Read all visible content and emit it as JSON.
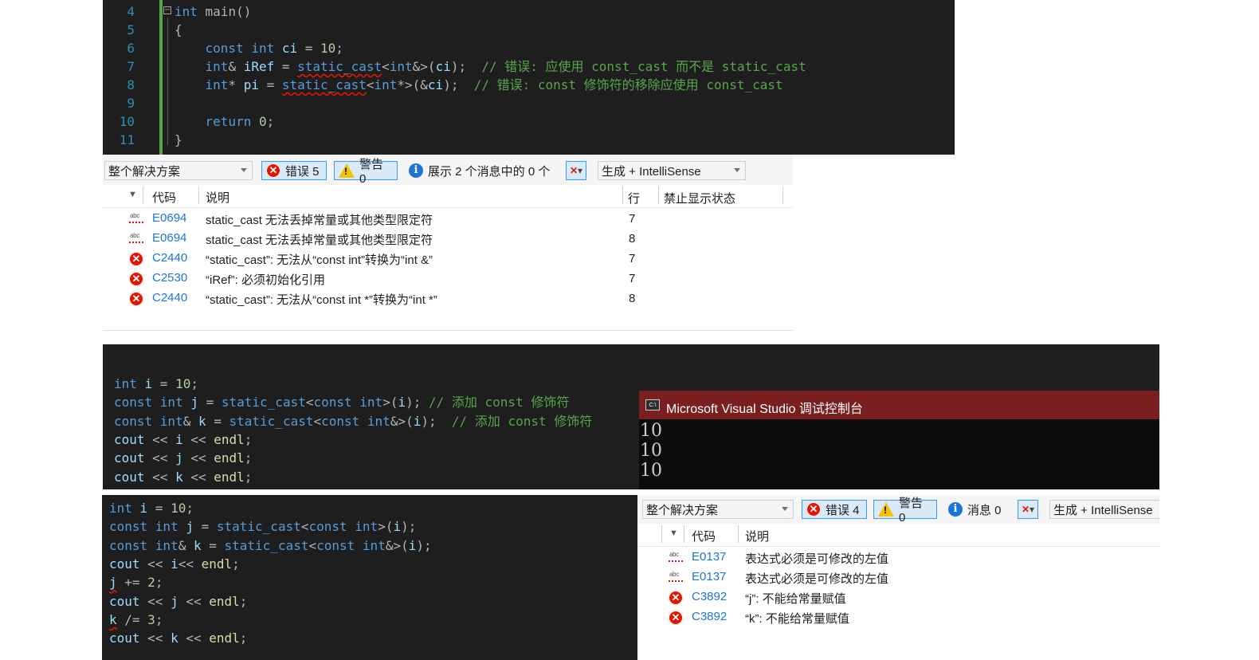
{
  "top_editor": {
    "lines": [
      {
        "num": "4",
        "segments": [
          {
            "t": "int",
            "c": "kw"
          },
          {
            "t": " main()",
            "c": "op"
          }
        ]
      },
      {
        "num": "5",
        "segments": [
          {
            "t": "{",
            "c": "op"
          }
        ]
      },
      {
        "num": "6",
        "segments": [
          {
            "t": "    const int ",
            "c": "kw"
          },
          {
            "t": "ci",
            "c": "id"
          },
          {
            "t": " = ",
            "c": "op"
          },
          {
            "t": "10",
            "c": "nm"
          },
          {
            "t": ";",
            "c": "op"
          }
        ]
      },
      {
        "num": "7",
        "segments": [
          {
            "t": "    int",
            "c": "kw"
          },
          {
            "t": "& ",
            "c": "op"
          },
          {
            "t": "iRef",
            "c": "id"
          },
          {
            "t": " = ",
            "c": "op"
          },
          {
            "t": "static_cast",
            "c": "kw squig"
          },
          {
            "t": "<",
            "c": "op"
          },
          {
            "t": "int",
            "c": "kw"
          },
          {
            "t": "&>(",
            "c": "op"
          },
          {
            "t": "ci",
            "c": "id"
          },
          {
            "t": ");  ",
            "c": "op"
          },
          {
            "t": "// 错误: 应使用 const_cast 而不是 static_cast",
            "c": "cm"
          }
        ]
      },
      {
        "num": "8",
        "segments": [
          {
            "t": "    int",
            "c": "kw"
          },
          {
            "t": "* ",
            "c": "op"
          },
          {
            "t": "pi",
            "c": "id"
          },
          {
            "t": " = ",
            "c": "op"
          },
          {
            "t": "static_cast",
            "c": "kw squig"
          },
          {
            "t": "<",
            "c": "op"
          },
          {
            "t": "int",
            "c": "kw"
          },
          {
            "t": "*>(&",
            "c": "op"
          },
          {
            "t": "ci",
            "c": "id"
          },
          {
            "t": ");  ",
            "c": "op"
          },
          {
            "t": "// 错误: const 修饰符的移除应使用 const_cast",
            "c": "cm"
          }
        ]
      },
      {
        "num": "9",
        "segments": []
      },
      {
        "num": "10",
        "segments": [
          {
            "t": "    return ",
            "c": "kw"
          },
          {
            "t": "0",
            "c": "nm"
          },
          {
            "t": ";",
            "c": "op"
          }
        ]
      },
      {
        "num": "11",
        "segments": [
          {
            "t": "}",
            "c": "op"
          }
        ]
      }
    ]
  },
  "error_list_1": {
    "scope": "整个解决方案",
    "errors_label": "错误 5",
    "warnings_label": "警告 0",
    "messages_label": "展示 2 个消息中的 0 个",
    "build_label": "生成 + IntelliSense",
    "headers": {
      "code": "代码",
      "desc": "说明",
      "line": "行",
      "suppress": "禁止显示状态"
    },
    "rows": [
      {
        "icon": "abc",
        "code": "E0694",
        "desc": "static_cast 无法丢掉常量或其他类型限定符",
        "line": "7"
      },
      {
        "icon": "abc",
        "code": "E0694",
        "desc": "static_cast 无法丢掉常量或其他类型限定符",
        "line": "8"
      },
      {
        "icon": "err",
        "code": "C2440",
        "desc": "“static_cast”: 无法从“const int”转换为“int &”",
        "line": "7"
      },
      {
        "icon": "err",
        "code": "C2530",
        "desc": "“iRef”: 必须初始化引用",
        "line": "7"
      },
      {
        "icon": "err",
        "code": "C2440",
        "desc": "“static_cast”: 无法从“const int *”转换为“int *”",
        "line": "8"
      }
    ]
  },
  "mid_editor": {
    "lines": [
      [
        {
          "t": "int ",
          "c": "kw"
        },
        {
          "t": "i",
          "c": "id"
        },
        {
          "t": " = ",
          "c": "op"
        },
        {
          "t": "10",
          "c": "nm"
        },
        {
          "t": ";",
          "c": "op"
        }
      ],
      [
        {
          "t": "const int ",
          "c": "kw"
        },
        {
          "t": "j",
          "c": "id"
        },
        {
          "t": " = ",
          "c": "op"
        },
        {
          "t": "static_cast",
          "c": "kw"
        },
        {
          "t": "<",
          "c": "op"
        },
        {
          "t": "const int",
          "c": "kw"
        },
        {
          "t": ">(",
          "c": "op"
        },
        {
          "t": "i",
          "c": "id"
        },
        {
          "t": "); ",
          "c": "op"
        },
        {
          "t": "// 添加 const 修饰符",
          "c": "cm"
        }
      ],
      [
        {
          "t": "const int",
          "c": "kw"
        },
        {
          "t": "& ",
          "c": "op"
        },
        {
          "t": "k",
          "c": "id"
        },
        {
          "t": " = ",
          "c": "op"
        },
        {
          "t": "static_cast",
          "c": "kw"
        },
        {
          "t": "<",
          "c": "op"
        },
        {
          "t": "const int",
          "c": "kw"
        },
        {
          "t": "&>(",
          "c": "op"
        },
        {
          "t": "i",
          "c": "id"
        },
        {
          "t": ");  ",
          "c": "op"
        },
        {
          "t": "// 添加 const 修饰符",
          "c": "cm"
        }
      ],
      [
        {
          "t": "cout",
          "c": "id"
        },
        {
          "t": " << ",
          "c": "op"
        },
        {
          "t": "i",
          "c": "id"
        },
        {
          "t": " << ",
          "c": "op"
        },
        {
          "t": "endl",
          "c": "fn"
        },
        {
          "t": ";",
          "c": "op"
        }
      ],
      [
        {
          "t": "cout",
          "c": "id"
        },
        {
          "t": " << ",
          "c": "op"
        },
        {
          "t": "j",
          "c": "id"
        },
        {
          "t": " << ",
          "c": "op"
        },
        {
          "t": "endl",
          "c": "fn"
        },
        {
          "t": ";",
          "c": "op"
        }
      ],
      [
        {
          "t": "cout",
          "c": "id"
        },
        {
          "t": " << ",
          "c": "op"
        },
        {
          "t": "k",
          "c": "id"
        },
        {
          "t": " << ",
          "c": "op"
        },
        {
          "t": "endl",
          "c": "fn"
        },
        {
          "t": ";",
          "c": "op"
        }
      ]
    ]
  },
  "console": {
    "title": "Microsoft Visual Studio 调试控制台",
    "output": [
      "10",
      "10",
      "10"
    ]
  },
  "bottom_editor": {
    "lines": [
      [
        {
          "t": "int ",
          "c": "kw"
        },
        {
          "t": "i",
          "c": "id"
        },
        {
          "t": " = ",
          "c": "op"
        },
        {
          "t": "10",
          "c": "nm"
        },
        {
          "t": ";",
          "c": "op"
        }
      ],
      [
        {
          "t": "const int ",
          "c": "kw"
        },
        {
          "t": "j",
          "c": "id"
        },
        {
          "t": " = ",
          "c": "op"
        },
        {
          "t": "static_cast",
          "c": "kw"
        },
        {
          "t": "<",
          "c": "op"
        },
        {
          "t": "const int",
          "c": "kw"
        },
        {
          "t": ">(",
          "c": "op"
        },
        {
          "t": "i",
          "c": "id"
        },
        {
          "t": ");",
          "c": "op"
        }
      ],
      [
        {
          "t": "const int",
          "c": "kw"
        },
        {
          "t": "& ",
          "c": "op"
        },
        {
          "t": "k",
          "c": "id"
        },
        {
          "t": " = ",
          "c": "op"
        },
        {
          "t": "static_cast",
          "c": "kw"
        },
        {
          "t": "<",
          "c": "op"
        },
        {
          "t": "const int",
          "c": "kw"
        },
        {
          "t": "&>(",
          "c": "op"
        },
        {
          "t": "i",
          "c": "id"
        },
        {
          "t": ");",
          "c": "op"
        }
      ],
      [
        {
          "t": "cout",
          "c": "id"
        },
        {
          "t": " << ",
          "c": "op"
        },
        {
          "t": "i",
          "c": "id"
        },
        {
          "t": "<< ",
          "c": "op"
        },
        {
          "t": "endl",
          "c": "fn"
        },
        {
          "t": ";",
          "c": "op"
        }
      ],
      [
        {
          "t": "j",
          "c": "id squig"
        },
        {
          "t": " += ",
          "c": "op"
        },
        {
          "t": "2",
          "c": "nm"
        },
        {
          "t": ";",
          "c": "op"
        }
      ],
      [
        {
          "t": "cout",
          "c": "id"
        },
        {
          "t": " << ",
          "c": "op"
        },
        {
          "t": "j",
          "c": "id"
        },
        {
          "t": " << ",
          "c": "op"
        },
        {
          "t": "endl",
          "c": "fn"
        },
        {
          "t": ";",
          "c": "op"
        }
      ],
      [
        {
          "t": "k",
          "c": "id squig"
        },
        {
          "t": " /= ",
          "c": "op"
        },
        {
          "t": "3",
          "c": "nm"
        },
        {
          "t": ";",
          "c": "op"
        }
      ],
      [
        {
          "t": "cout",
          "c": "id"
        },
        {
          "t": " << ",
          "c": "op"
        },
        {
          "t": "k",
          "c": "id"
        },
        {
          "t": " << ",
          "c": "op"
        },
        {
          "t": "endl",
          "c": "fn"
        },
        {
          "t": ";",
          "c": "op"
        }
      ]
    ]
  },
  "error_list_2": {
    "scope": "整个解决方案",
    "errors_label": "错误 4",
    "warnings_label": "警告 0",
    "messages_label": "消息 0",
    "build_label": "生成 + IntelliSense",
    "headers": {
      "code": "代码",
      "desc": "说明"
    },
    "rows": [
      {
        "icon": "abc",
        "code": "E0137",
        "desc": "表达式必须是可修改的左值"
      },
      {
        "icon": "abc",
        "code": "E0137",
        "desc": "表达式必须是可修改的左值"
      },
      {
        "icon": "err",
        "code": "C3892",
        "desc": "“j”: 不能给常量赋值"
      },
      {
        "icon": "err",
        "code": "C3892",
        "desc": "“k”: 不能给常量赋值"
      }
    ]
  }
}
